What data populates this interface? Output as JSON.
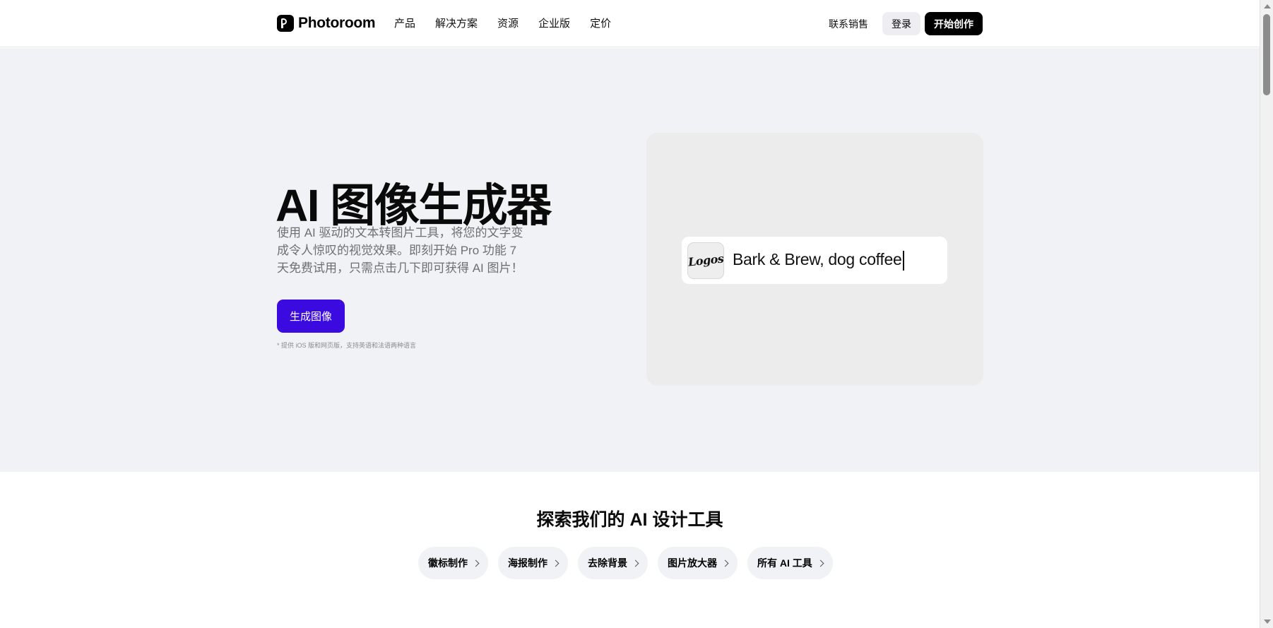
{
  "header": {
    "brand": "Photoroom",
    "menu": [
      {
        "label": "产品"
      },
      {
        "label": "解决方案"
      },
      {
        "label": "资源"
      },
      {
        "label": "企业版"
      },
      {
        "label": "定价"
      }
    ],
    "contact_sales": "联系销售",
    "login": "登录",
    "start": "开始创作"
  },
  "hero": {
    "title": "AI 图像生成器",
    "description": "使用 AI 驱动的文本转图片工具，将您的文字变成令人惊叹的视觉效果。即刻开始 Pro 功能 7 天免费试用，只需点击几下即可获得 AI 图片！",
    "cta": "生成图像",
    "note": "* 提供 iOS 版和网页版，支持英语和法语两种语言",
    "demo": {
      "thumb_label": "Logos",
      "prompt": "Bark & Brew, dog coffee"
    }
  },
  "tools": {
    "title": "探索我们的 AI 设计工具",
    "chips": [
      {
        "label": "徽标制作"
      },
      {
        "label": "海报制作"
      },
      {
        "label": "去除背景"
      },
      {
        "label": "图片放大器"
      },
      {
        "label": "所有 AI 工具"
      }
    ]
  },
  "colors": {
    "accent": "#3a0ae0",
    "hero_bg": "#f1f2f5",
    "card_bg": "#ececec"
  }
}
